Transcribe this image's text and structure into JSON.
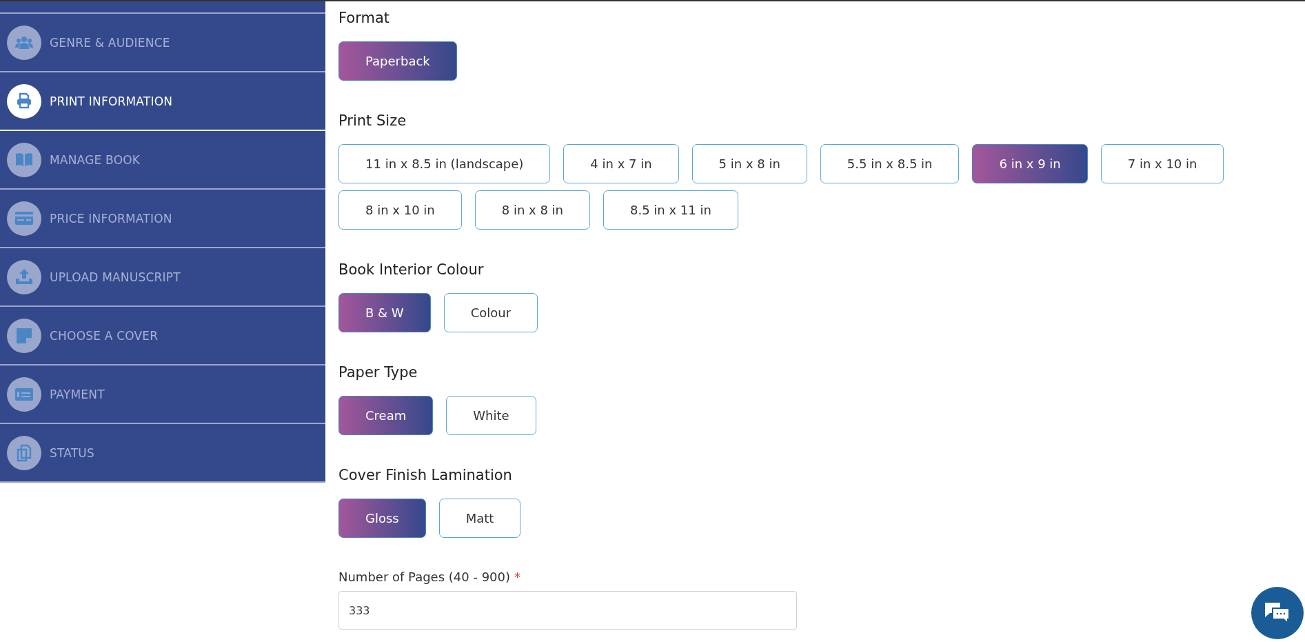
{
  "sidebar": {
    "items": [
      {
        "label": "GENRE & AUDIENCE",
        "selected": false
      },
      {
        "label": "PRINT INFORMATION",
        "selected": true
      },
      {
        "label": "MANAGE BOOK",
        "selected": false
      },
      {
        "label": "PRICE INFORMATION",
        "selected": false
      },
      {
        "label": "UPLOAD MANUSCRIPT",
        "selected": false
      },
      {
        "label": "CHOOSE A COVER",
        "selected": false
      },
      {
        "label": "PAYMENT",
        "selected": false
      },
      {
        "label": "STATUS",
        "selected": false
      }
    ]
  },
  "sections": [
    {
      "title": "Format",
      "options": [
        {
          "label": "Paperback",
          "selected": true
        }
      ]
    },
    {
      "title": "Print Size",
      "options": [
        {
          "label": "11 in x 8.5 in (landscape)",
          "selected": false
        },
        {
          "label": "4 in x 7 in",
          "selected": false
        },
        {
          "label": "5 in x 8 in",
          "selected": false
        },
        {
          "label": "5.5 in x 8.5 in",
          "selected": false
        },
        {
          "label": "6 in x 9 in",
          "selected": true
        },
        {
          "label": "7 in x 10 in",
          "selected": false
        },
        {
          "label": "8 in x 10 in",
          "selected": false
        },
        {
          "label": "8 in x 8 in",
          "selected": false
        },
        {
          "label": "8.5 in x 11 in",
          "selected": false
        }
      ]
    },
    {
      "title": "Book Interior Colour",
      "options": [
        {
          "label": "B & W",
          "selected": true
        },
        {
          "label": "Colour",
          "selected": false
        }
      ]
    },
    {
      "title": "Paper Type",
      "options": [
        {
          "label": "Cream",
          "selected": true
        },
        {
          "label": "White",
          "selected": false
        }
      ]
    },
    {
      "title": "Cover Finish Lamination",
      "options": [
        {
          "label": "Gloss",
          "selected": true
        },
        {
          "label": "Matt",
          "selected": false
        }
      ]
    }
  ],
  "pages_field": {
    "label": "Number of Pages (40 - 900)",
    "required": true,
    "required_mark": "*",
    "value": "333"
  }
}
